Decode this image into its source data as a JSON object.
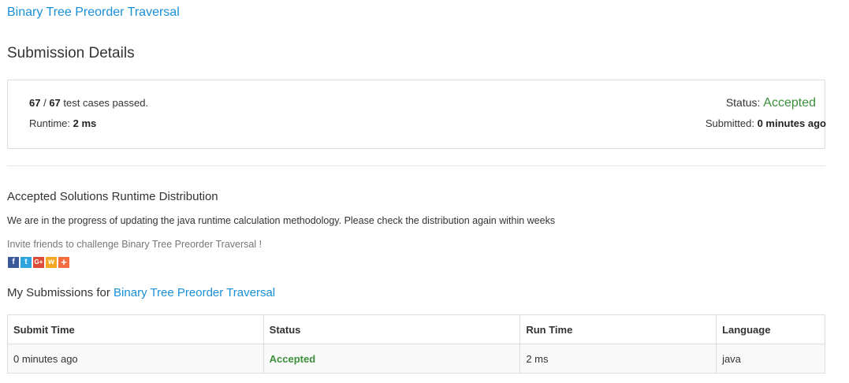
{
  "header": {
    "problem_link": "Binary Tree Preorder Traversal",
    "title": "Submission Details"
  },
  "details": {
    "passed": "67",
    "separator": " / ",
    "total": "67",
    "passed_suffix": " test cases passed.",
    "runtime_label": "Runtime: ",
    "runtime_value": "2 ms",
    "status_label": "Status: ",
    "status_value": "Accepted",
    "submitted_label": "Submitted: ",
    "submitted_value": "0 minutes ago"
  },
  "distribution": {
    "title": "Accepted Solutions Runtime Distribution",
    "note": "We are in the progress of updating the java runtime calculation methodology. Please check the distribution again within weeks",
    "invite": "Invite friends to challenge Binary Tree Preorder Traversal !"
  },
  "share": {
    "icons": [
      "facebook-icon",
      "twitter-icon",
      "google-plus-icon",
      "weibo-icon",
      "share-more-icon"
    ],
    "labels": [
      "f",
      "t",
      "G+",
      "w",
      "+"
    ]
  },
  "my_submissions": {
    "prefix": "My Submissions for ",
    "link": "Binary Tree Preorder Traversal"
  },
  "table": {
    "headers": [
      "Submit Time",
      "Status",
      "Run Time",
      "Language"
    ],
    "rows": [
      [
        "0 minutes ago",
        "Accepted",
        "2 ms",
        "java"
      ]
    ]
  },
  "colors": {
    "link": "#1a8fd6",
    "accepted": "#3c8f3c"
  }
}
